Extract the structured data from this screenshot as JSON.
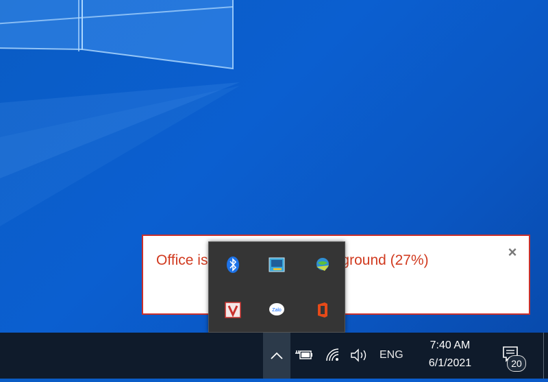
{
  "toast": {
    "text": "Office is installing in the background (27%)",
    "close_label": "×"
  },
  "tray_popup": {
    "icons": [
      "bluetooth-icon",
      "display-settings-icon",
      "internet-download-manager-icon",
      "vnpay-v-icon",
      "zalo-icon",
      "office-icon"
    ],
    "zalo_label": "Zalo"
  },
  "taskbar": {
    "chevron": "^",
    "language": "ENG",
    "time": "7:40 AM",
    "date": "6/1/2021",
    "notification_count": "20"
  },
  "colors": {
    "desktop": "#0a5cc4",
    "taskbar": "#0f1b2b",
    "toast_text": "#d13a1f",
    "toast_border": "#c9302c"
  }
}
